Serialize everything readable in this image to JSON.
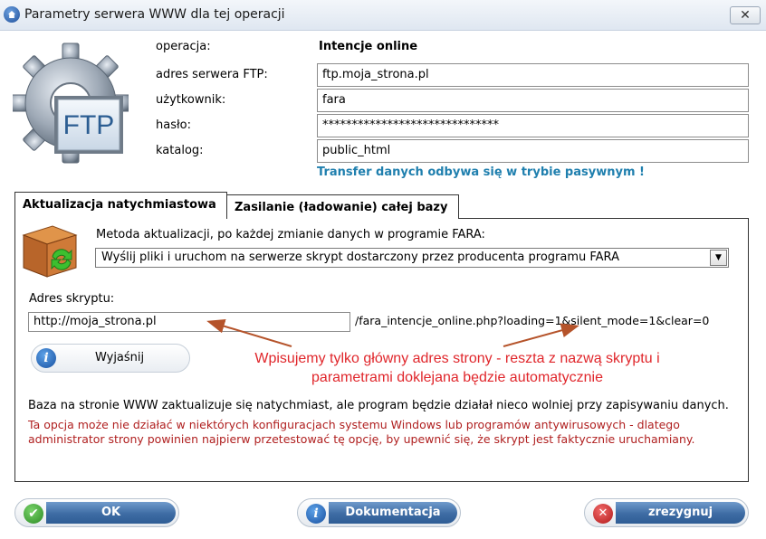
{
  "window": {
    "title": "Parametry serwera WWW dla tej operacji",
    "close_glyph": "✕"
  },
  "logo": {
    "text": "FTP"
  },
  "form": {
    "operation_label": "operacja:",
    "operation_value": "Intencje online",
    "server_label": "adres serwera FTP:",
    "server_value": "ftp.moja_strona.pl",
    "user_label": "użytkownik:",
    "user_value": "fara",
    "password_label": "hasło:",
    "password_value": "******************************",
    "dir_label": "katalog:",
    "dir_value": "public_html",
    "passive_note": "Transfer danych odbywa się w trybie pasywnym !"
  },
  "tabs": [
    {
      "label": "Aktualizacja natychmiastowa",
      "active": true
    },
    {
      "label": "Zasilanie (ładowanie) całej bazy",
      "active": false
    }
  ],
  "panel": {
    "method_label": "Metoda aktualizacji, po każdej zmianie danych w programie FARA:",
    "method_value": "Wyślij pliki i uruchom na serwerze skrypt dostarczony przez producenta programu FARA",
    "script_label": "Adres skryptu:",
    "script_value": "http://moja_strona.pl",
    "script_suffix": "/fara_intencje_online.php?loading=1&silent_mode=1&clear=0",
    "explain_button": "Wyjaśnij",
    "annotation_line1": "Wpisujemy tylko główny adres strony - reszta z nazwą skryptu i",
    "annotation_line2": "parametrami doklejana będzie automatycznie",
    "info_text": "Baza na stronie WWW zaktualizuje się natychmiast, ale program będzie działał nieco wolniej przy zapisywaniu danych.",
    "warning_text": "Ta opcja może nie działać w niektórych konfiguracjach systemu Windows lub programów antywirusowych - dlatego administrator strony powinien najpierw przetestować tę opcję, by upewnić się, że skrypt jest faktycznie uruchamiany."
  },
  "buttons": {
    "ok": "OK",
    "docs": "Dokumentacja",
    "cancel": "zrezygnuj"
  },
  "colors": {
    "accent_blue": "#3e6ca4",
    "note_blue": "#1f7fae",
    "annotation_red": "#e0262b",
    "warning_red": "#b02020"
  },
  "icons": {
    "app": "app-home-icon",
    "logo": "gear-ftp-icon",
    "update": "box-refresh-icon",
    "info": "info-icon",
    "ok": "checkmark-icon",
    "cancel": "cancel-x-icon"
  }
}
